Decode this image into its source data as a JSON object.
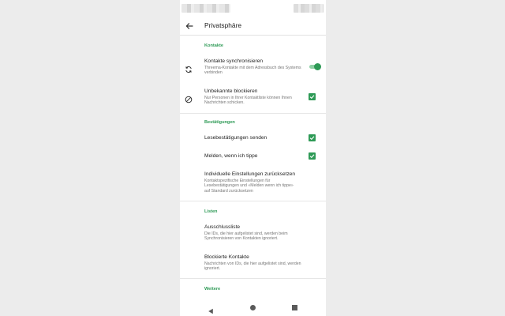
{
  "toolbar": {
    "title": "Privatsphäre",
    "back_icon": "arrow-left-icon"
  },
  "accent_color": "#2e9a56",
  "sections": {
    "kontakte": {
      "header": "Kontakte",
      "sync": {
        "title": "Kontakte synchronisieren",
        "summary": "Threema-Kontakte mit dem Adressbuch des Systems verbinden",
        "icon": "sync-icon",
        "enabled": true
      },
      "block_unknown": {
        "title": "Unbekannte blockieren",
        "summary": "Nur Personen in Ihrer Kontaktliste können Ihnen Nachrichten schicken.",
        "icon": "block-icon",
        "checked": true
      }
    },
    "bestaetigungen": {
      "header": "Bestätigungen",
      "read_receipts": {
        "title": "Lesebestätigungen senden",
        "checked": true
      },
      "typing": {
        "title": "Melden, wenn ich tippe",
        "checked": true
      },
      "reset": {
        "title": "Individuelle Einstellungen zurücksetzen",
        "summary": "Kontaktspezifische Einstellungen für Lesebestätigungen und «Melden wenn ich tippe» auf Standard zurücksetzen"
      }
    },
    "listen": {
      "header": "Listen",
      "exclusion": {
        "title": "Ausschlussliste",
        "summary": "Die IDs, die hier aufgelistet sind, werden beim Synchronisieren von Kontakten ignoriert."
      },
      "blocked": {
        "title": "Blockierte Kontakte",
        "summary": "Nachrichten von IDs, die hier aufgelistet sind, werden ignoriert."
      }
    },
    "weitere": {
      "header": "Weitere"
    }
  },
  "nav_bar": {
    "back": "nav-back-icon",
    "home": "nav-home-icon",
    "recent": "nav-recent-icon"
  }
}
